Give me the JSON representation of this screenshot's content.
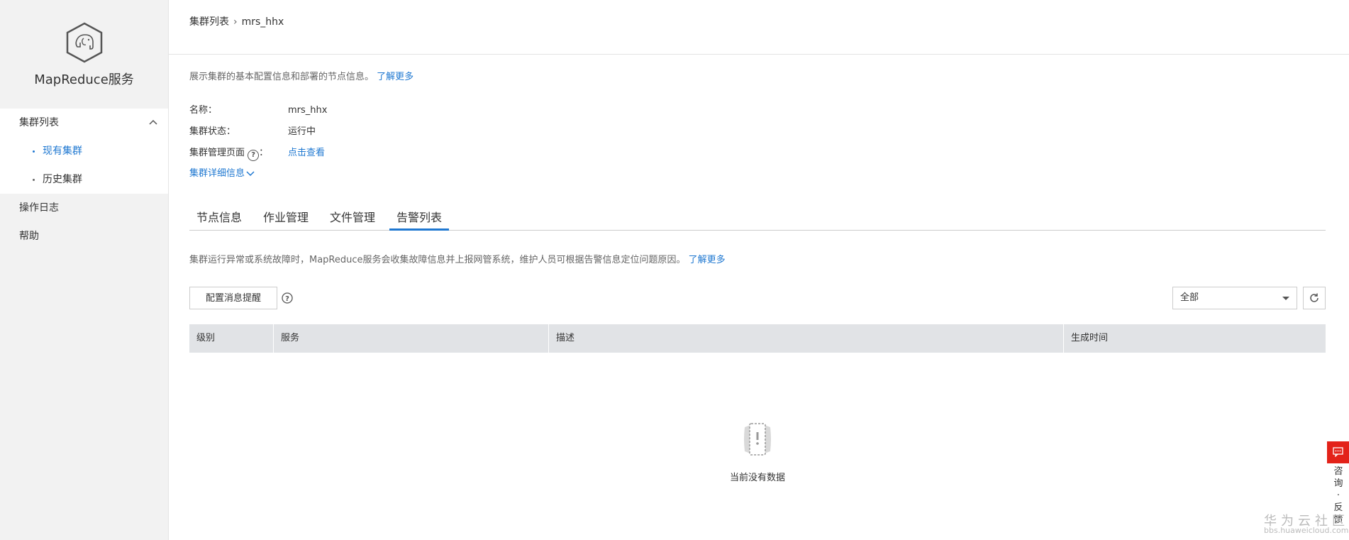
{
  "sidebar": {
    "service_title": "MapReduce服务",
    "group_label": "集群列表",
    "sub_items": [
      "现有集群",
      "历史集群"
    ],
    "items": [
      "操作日志",
      "帮助"
    ]
  },
  "header": {
    "breadcrumb_parent": "集群列表",
    "breadcrumb_current": "mrs_hhx"
  },
  "intro": {
    "text": "展示集群的基本配置信息和部署的节点信息。",
    "link": "了解更多"
  },
  "info": {
    "name_label": "名称：",
    "name_value": "mrs_hhx",
    "status_label": "集群状态：",
    "status_value": "运行中",
    "manage_label": "集群管理页面",
    "manage_colon": "：",
    "manage_link": "点击查看",
    "detail_toggle": "集群详细信息"
  },
  "tabs": [
    "节点信息",
    "作业管理",
    "文件管理",
    "告警列表"
  ],
  "active_tab": "告警列表",
  "alerts": {
    "desc": "集群运行异常或系统故障时，MapReduce服务会收集故障信息并上报网管系统，维护人员可根据告警信息定位问题原因。",
    "link": "了解更多",
    "config_button": "配置消息提醒",
    "filter_value": "全部",
    "columns": [
      "级别",
      "服务",
      "描述",
      "生成时间"
    ],
    "empty_text": "当前没有数据"
  },
  "feedback": {
    "label": "咨询·反馈"
  },
  "watermark": {
    "text": "华为云社区",
    "url": "bbs.huaweicloud.com"
  },
  "colors": {
    "accent": "#1f78d1",
    "sidebar_bg": "#f2f2f2",
    "table_header_bg": "#e1e3e6",
    "feedback_red": "#e32219"
  }
}
